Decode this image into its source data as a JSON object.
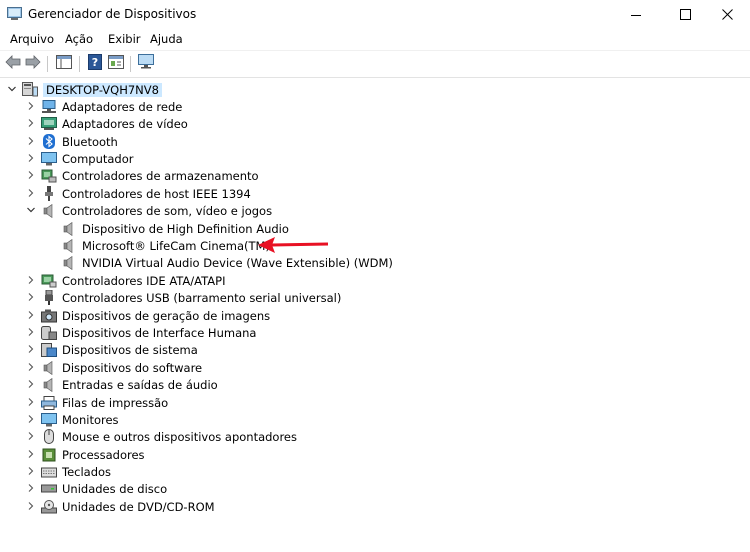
{
  "window": {
    "title": "Gerenciador de Dispositivos"
  },
  "menu": [
    "Arquivo",
    "Ação",
    "Exibir",
    "Ajuda"
  ],
  "tree": {
    "root": "DESKTOP-VQH7NV8",
    "categories": [
      {
        "label": "Adaptadores de rede",
        "icon": "network-adapter-icon"
      },
      {
        "label": "Adaptadores de vídeo",
        "icon": "display-adapter-icon"
      },
      {
        "label": "Bluetooth",
        "icon": "bluetooth-icon"
      },
      {
        "label": "Computador",
        "icon": "computer-icon"
      },
      {
        "label": "Controladores de armazenamento",
        "icon": "storage-controller-icon"
      },
      {
        "label": "Controladores de host IEEE 1394",
        "icon": "ieee1394-icon"
      },
      {
        "label": "Controladores de som, vídeo e jogos",
        "icon": "speaker-icon",
        "expanded": true,
        "children": [
          {
            "label": "Dispositivo de High Definition Audio",
            "icon": "speaker-icon"
          },
          {
            "label": "Microsoft® LifeCam Cinema(TM)",
            "icon": "speaker-icon"
          },
          {
            "label": "NVIDIA Virtual Audio Device (Wave Extensible) (WDM)",
            "icon": "speaker-icon"
          }
        ]
      },
      {
        "label": "Controladores IDE ATA/ATAPI",
        "icon": "ide-controller-icon"
      },
      {
        "label": "Controladores USB (barramento serial universal)",
        "icon": "usb-icon"
      },
      {
        "label": "Dispositivos de geração de imagens",
        "icon": "camera-icon"
      },
      {
        "label": "Dispositivos de Interface Humana",
        "icon": "hid-icon"
      },
      {
        "label": "Dispositivos de sistema",
        "icon": "system-device-icon"
      },
      {
        "label": "Dispositivos do software",
        "icon": "software-device-icon"
      },
      {
        "label": "Entradas e saídas de áudio",
        "icon": "audio-io-icon"
      },
      {
        "label": "Filas de impressão",
        "icon": "printer-icon"
      },
      {
        "label": "Monitores",
        "icon": "monitor-icon"
      },
      {
        "label": "Mouse e outros dispositivos apontadores",
        "icon": "mouse-icon"
      },
      {
        "label": "Processadores",
        "icon": "processor-icon"
      },
      {
        "label": "Teclados",
        "icon": "keyboard-icon"
      },
      {
        "label": "Unidades de disco",
        "icon": "disk-drive-icon"
      },
      {
        "label": "Unidades de DVD/CD-ROM",
        "icon": "dvd-drive-icon"
      }
    ]
  },
  "annotation": {
    "arrow_color": "#e81123"
  }
}
